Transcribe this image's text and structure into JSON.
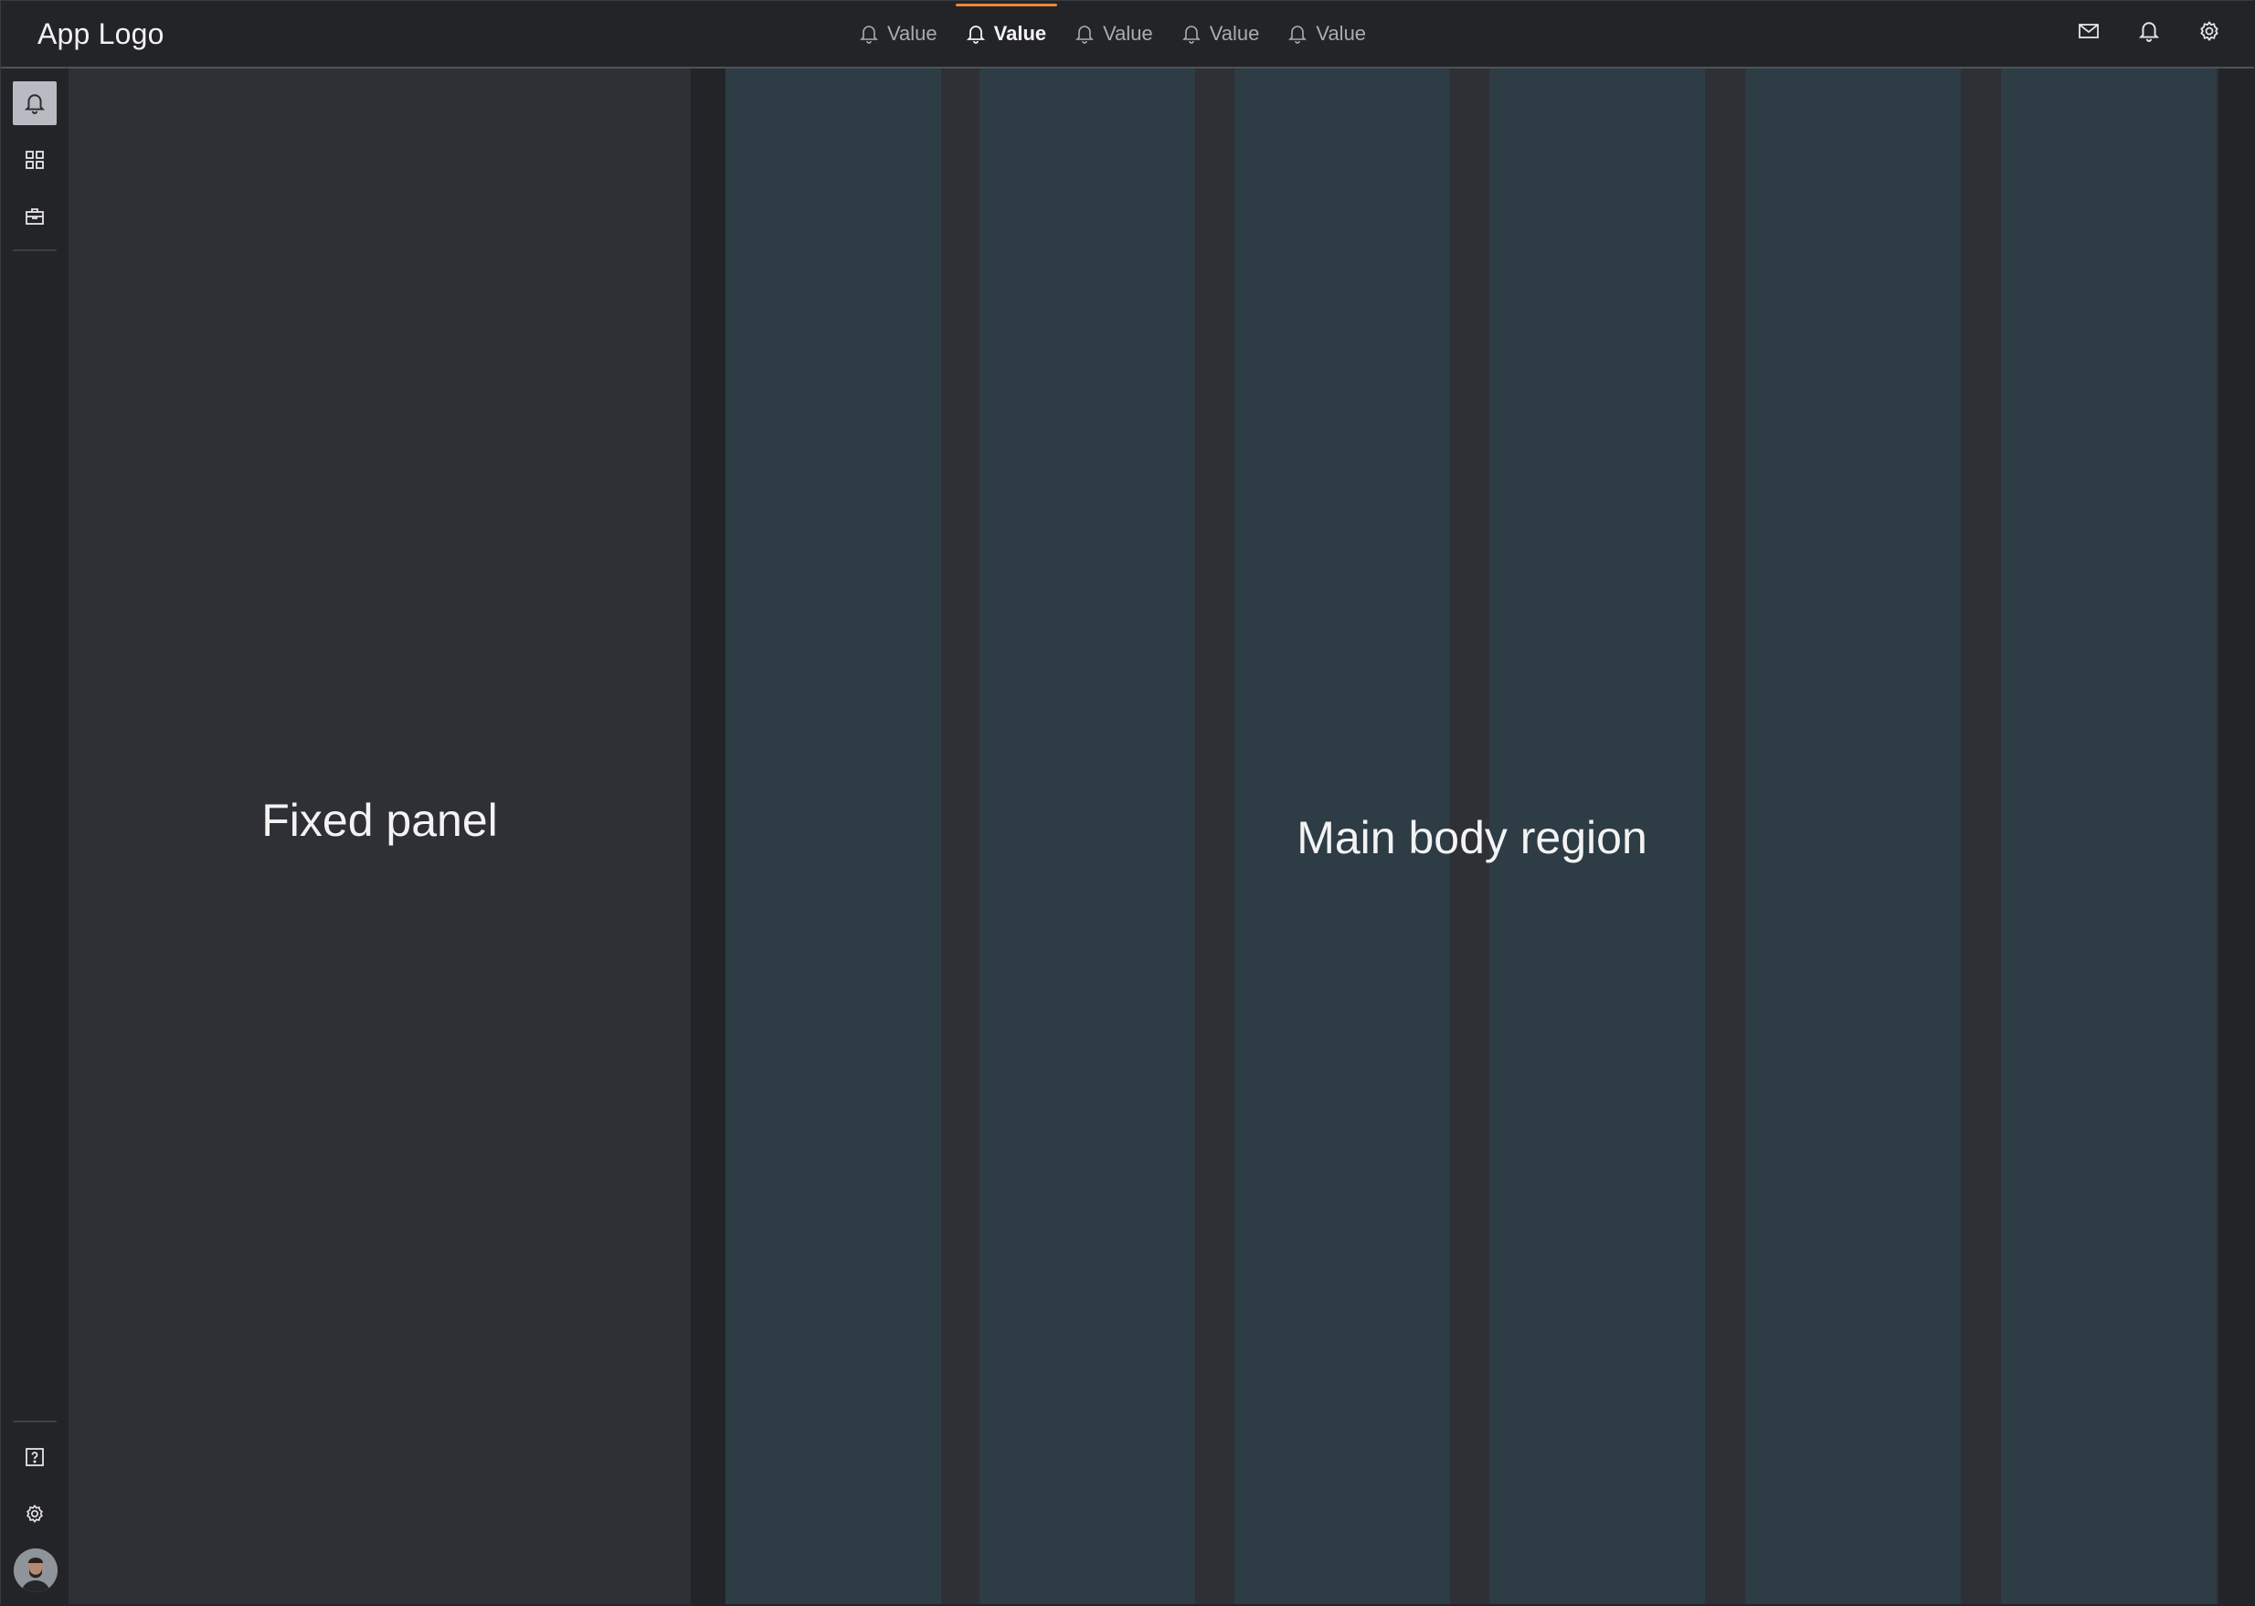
{
  "header": {
    "logo": "App Logo",
    "tabs": [
      {
        "label": "Value",
        "icon": "bell-icon",
        "active": false
      },
      {
        "label": "Value",
        "icon": "bell-icon",
        "active": true
      },
      {
        "label": "Value",
        "icon": "bell-icon",
        "active": false
      },
      {
        "label": "Value",
        "icon": "bell-icon",
        "active": false
      },
      {
        "label": "Value",
        "icon": "bell-icon",
        "active": false
      }
    ],
    "actions": [
      "mail-icon",
      "bell-icon",
      "gear-icon"
    ]
  },
  "rail": {
    "top_items": [
      "bell-icon",
      "grid-icon",
      "briefcase-icon"
    ],
    "active_index": 0,
    "bottom_items": [
      "help-icon",
      "gear-icon",
      "avatar"
    ]
  },
  "fixed_panel": {
    "label": "Fixed panel"
  },
  "main": {
    "label": "Main body region",
    "column_count": 6
  },
  "colors": {
    "accent": "#e8893a",
    "background": "#232427",
    "panel": "#2f3036",
    "column": "#2d3c45",
    "text": "#f3f3f4"
  }
}
